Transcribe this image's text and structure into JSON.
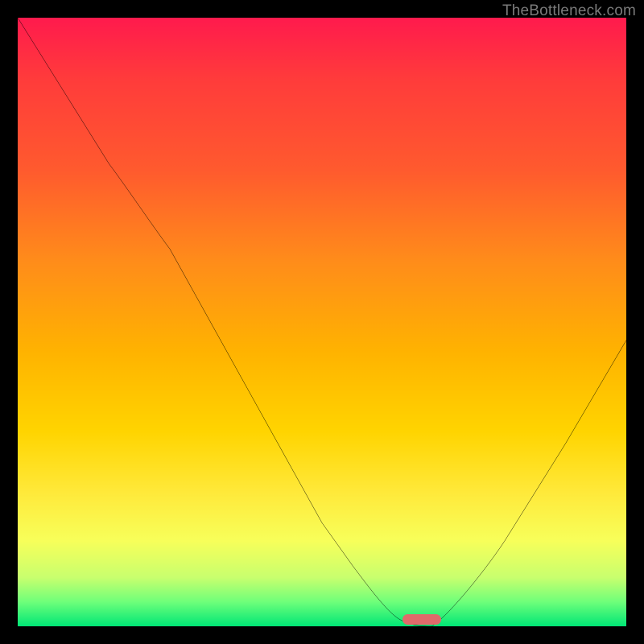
{
  "watermark": "TheBottleneck.com",
  "colors": {
    "frame": "#000000",
    "curve": "#000000",
    "marker": "#e06a6a",
    "gradient_top": "#ff1a4d",
    "gradient_bottom": "#00e676"
  },
  "chart_data": {
    "type": "line",
    "title": "",
    "xlabel": "",
    "ylabel": "",
    "xlim": [
      0,
      100
    ],
    "ylim": [
      0,
      100
    ],
    "x": [
      0,
      5,
      10,
      15,
      20,
      25,
      30,
      35,
      40,
      45,
      50,
      55,
      60,
      63,
      66,
      68,
      72,
      80,
      90,
      100
    ],
    "values": [
      100,
      92,
      84,
      76,
      70,
      62,
      53,
      44,
      35,
      26,
      17,
      10,
      4,
      1,
      0,
      0,
      3,
      14,
      30,
      47
    ],
    "marker": {
      "x_center": 67,
      "width": 6,
      "y": 0
    }
  }
}
